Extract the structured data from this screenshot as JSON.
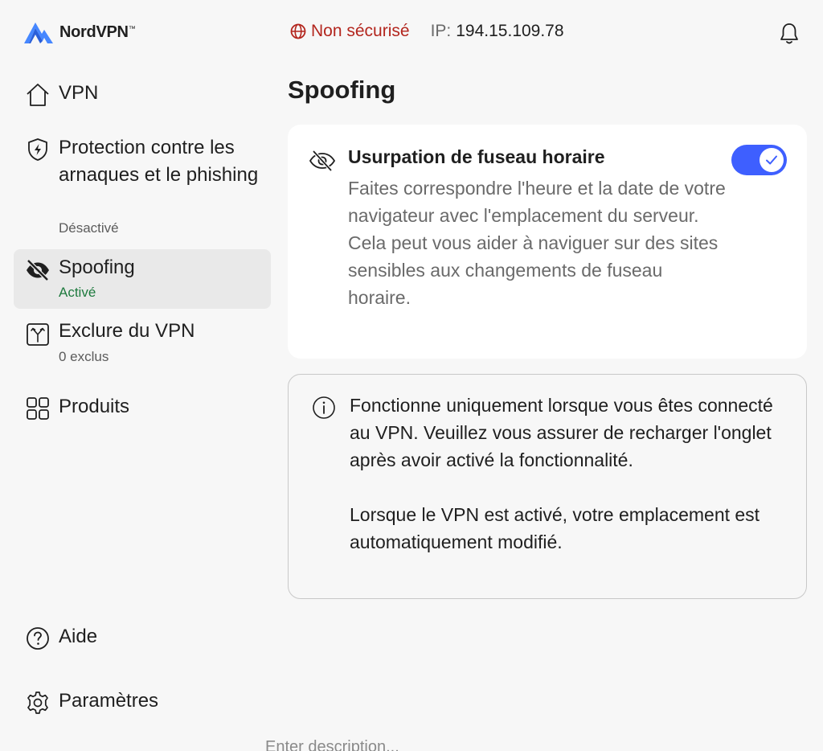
{
  "header": {
    "logo_text": "NordVPN",
    "logo_mark": "™",
    "status": "Non sécurisé",
    "ip_label": "IP:",
    "ip_value": "194.15.109.78"
  },
  "sidebar": {
    "items": [
      {
        "label": "VPN",
        "icon": "home-icon"
      },
      {
        "label": "Protection contre les arnaques et le phishing",
        "sub": "Désactivé",
        "icon": "shield-bolt-icon"
      },
      {
        "label": "Spoofing",
        "sub": "Activé",
        "icon": "eye-slash-icon",
        "active": true
      },
      {
        "label": "Exclure du VPN",
        "sub": "0 exclus",
        "icon": "split-tunnel-icon"
      },
      {
        "label": "Produits",
        "icon": "grid-icon"
      },
      {
        "label": "Aide",
        "icon": "help-icon"
      },
      {
        "label": "Paramètres",
        "icon": "gear-icon"
      }
    ]
  },
  "main": {
    "title": "Spoofing",
    "feature": {
      "title": "Usurpation de fuseau horaire",
      "description": "Faites correspondre l'heure et la date de votre navigateur avec l'emplacement du serveur. Cela peut vous aider à naviguer sur des sites sensibles aux changements de fuseau horaire.",
      "enabled": true
    },
    "info": {
      "paragraph1": "Fonctionne uniquement lorsque vous êtes connecté au VPN. Veuillez vous assurer de recharger l'onglet après avoir activé la fonctionnalité.",
      "paragraph2": "Lorsque le VPN est activé, votre emplacement est automatiquement modifié."
    }
  },
  "footer_fragment": "Enter description...",
  "colors": {
    "accent": "#3e5fff",
    "danger": "#b3261e",
    "success": "#1e7a3e",
    "logo_blue": "#4687ff",
    "background": "#f7f7f7"
  }
}
